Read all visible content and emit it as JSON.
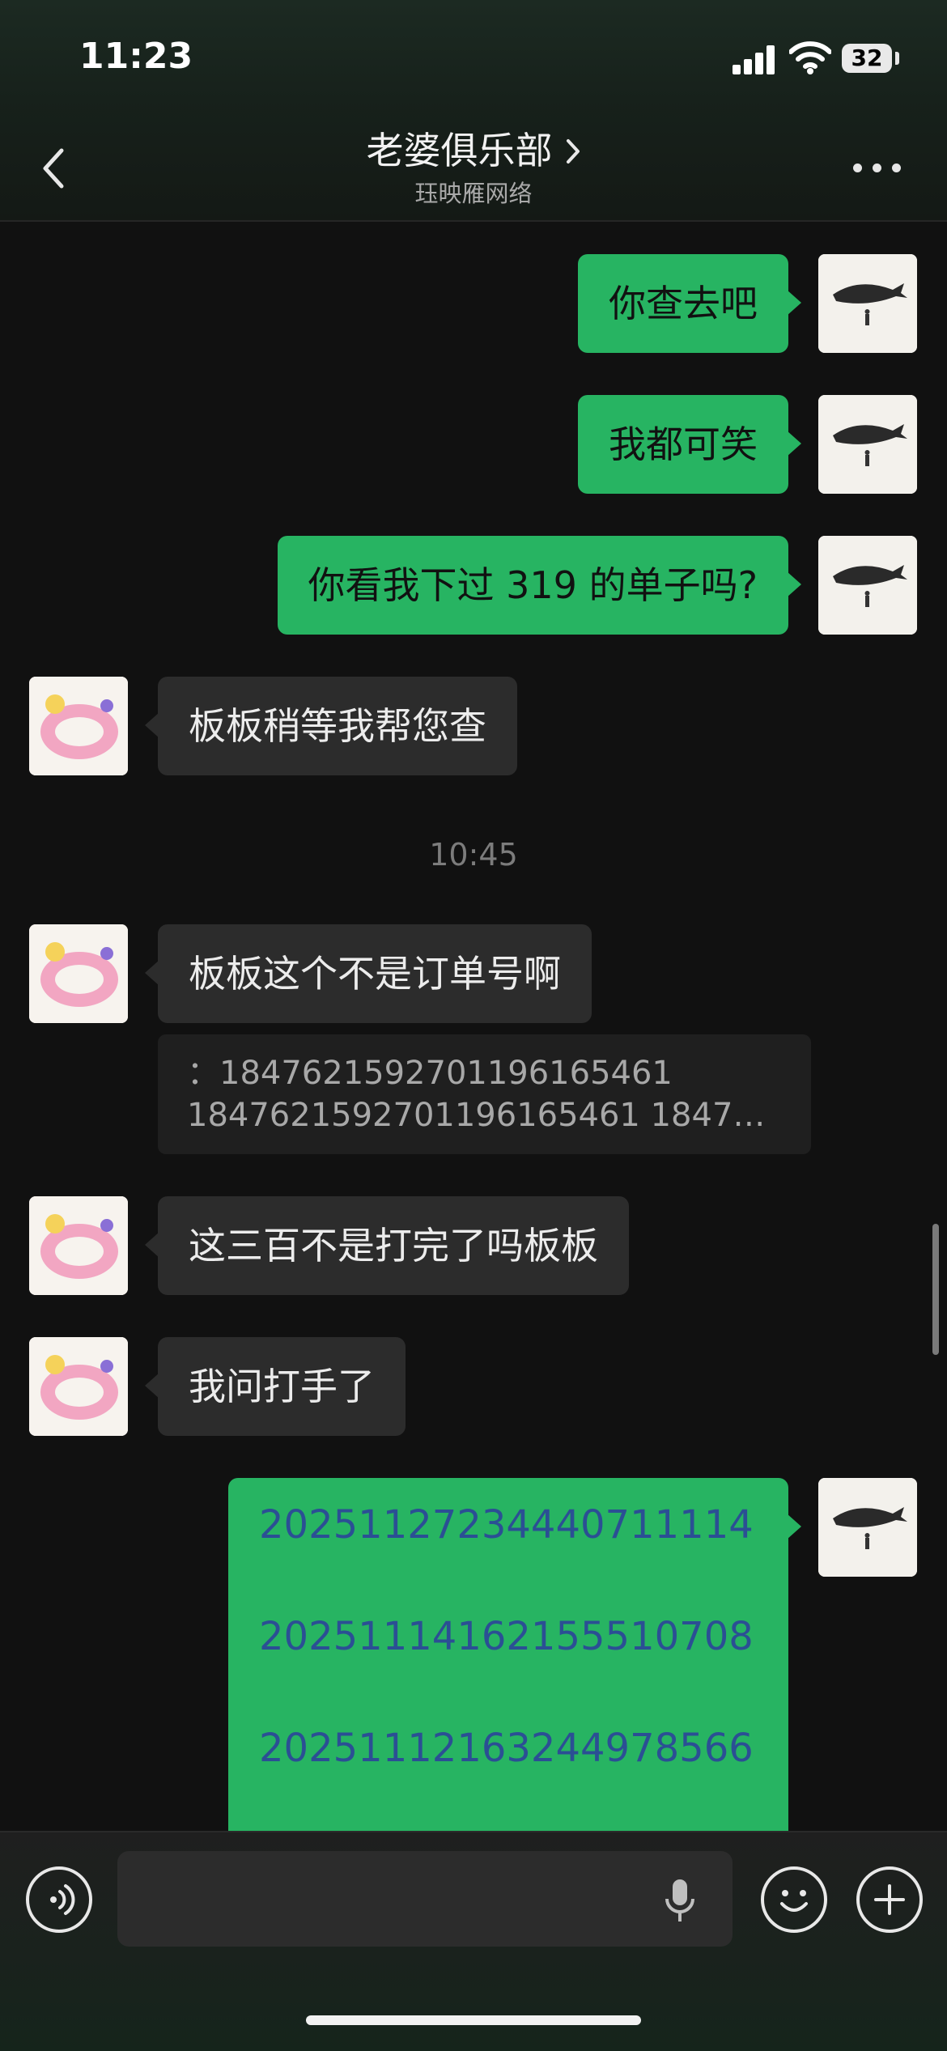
{
  "status_bar": {
    "time": "11:23",
    "battery": "32"
  },
  "header": {
    "title": "老婆俱乐部",
    "subtitle": "珏映雁网络"
  },
  "messages": {
    "m1": "你查去吧",
    "m2": "我都可笑",
    "m3": "你看我下过 319 的单子吗?",
    "m4": "板板稍等我帮您查",
    "timestamp": "10:45",
    "m5": "板板这个不是订单号啊",
    "quote_line1": "：1847621592701196165461",
    "quote_line2": "1847621592701196165461  184762...",
    "m6": "这三百不是打完了吗板板",
    "m7": "我问打手了",
    "orders": [
      "20251127234440711114",
      "20251114162155510708",
      "20251112163244978566"
    ]
  },
  "input": {
    "placeholder": ""
  },
  "icons": {
    "back": "chevron-left-icon",
    "more": "more-icon",
    "voice": "voice-icon",
    "mic": "mic-icon",
    "emoji": "emoji-icon",
    "plus": "plus-icon"
  },
  "colors": {
    "my_bubble": "#27b462",
    "other_bubble": "#2c2c2c",
    "background": "#111111",
    "order_text": "#2b4f94"
  }
}
